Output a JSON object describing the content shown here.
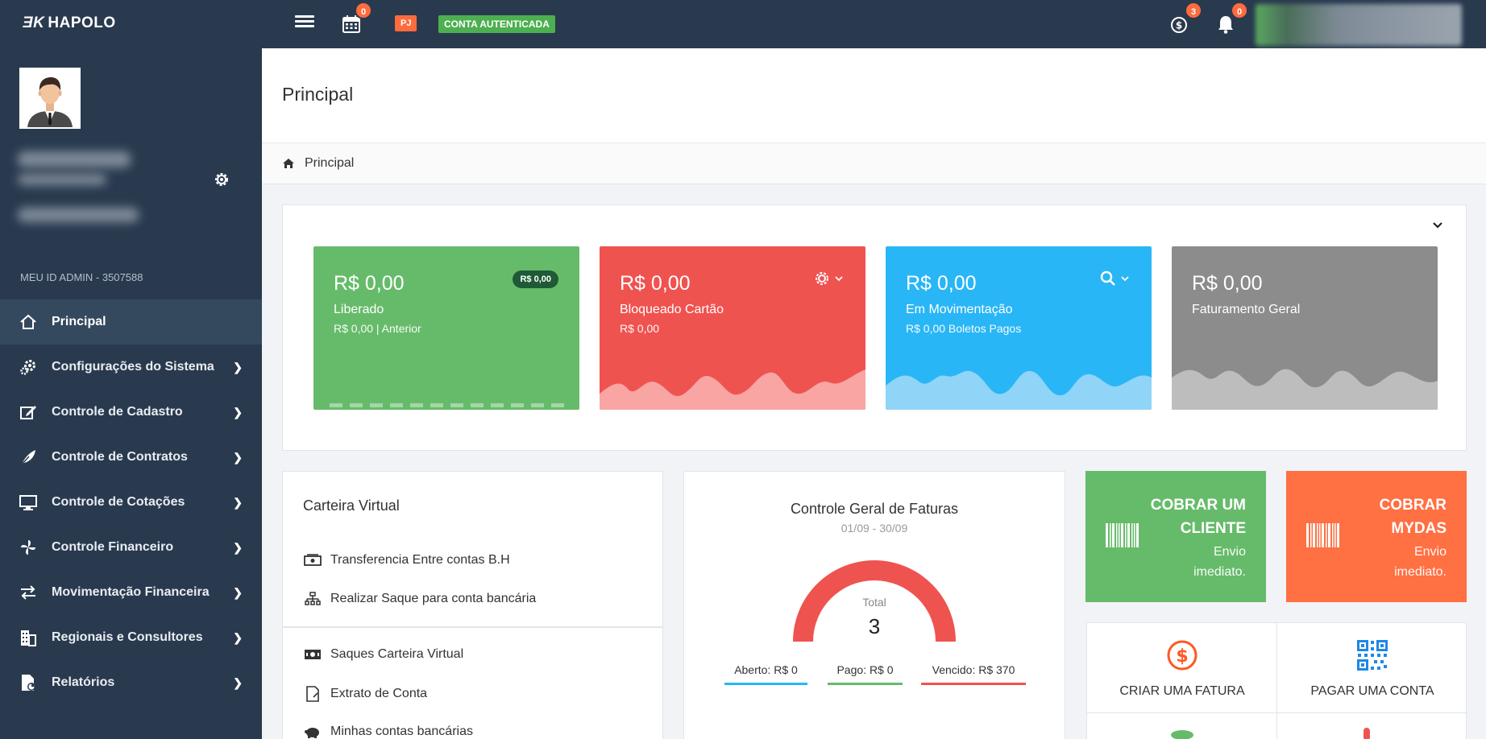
{
  "brand": {
    "mark": "ƎK",
    "name": "HAPOLO"
  },
  "topbar": {
    "calendar_count": "0",
    "pj_label": "PJ",
    "auth_label": "CONTA AUTENTICADA",
    "dollar_count": "3",
    "bell_count": "0"
  },
  "sidebar": {
    "admin_id": "MEU ID ADMIN - 3507588",
    "items": [
      {
        "label": "Principal",
        "icon": "home-icon"
      },
      {
        "label": "Configurações do Sistema",
        "icon": "cogs-icon"
      },
      {
        "label": "Controle de Cadastro",
        "icon": "edit-icon"
      },
      {
        "label": "Controle de Contratos",
        "icon": "feather-icon"
      },
      {
        "label": "Controle de Cotações",
        "icon": "monitor-icon"
      },
      {
        "label": "Controle Financeiro",
        "icon": "pinwheel-icon"
      },
      {
        "label": "Movimentação Financeira",
        "icon": "exchange-icon"
      },
      {
        "label": "Regionais e Consultores",
        "icon": "building-icon"
      },
      {
        "label": "Relatórios",
        "icon": "report-icon"
      }
    ]
  },
  "page": {
    "title": "Principal",
    "breadcrumb": "Principal"
  },
  "cards": [
    {
      "amount": "R$ 0,00",
      "label": "Liberado",
      "sub": "R$ 0,00 | Anterior",
      "pill": "R$ 0,00",
      "color": "#66bb6a"
    },
    {
      "amount": "R$ 0,00",
      "label": "Bloqueado Cartão",
      "sub": "R$ 0,00",
      "color": "#ef5350"
    },
    {
      "amount": "R$ 0,00",
      "label": "Em Movimentação",
      "sub": "R$ 0,00 Boletos Pagos",
      "color": "#29b6f6"
    },
    {
      "amount": "R$ 0,00",
      "label": "Faturamento Geral",
      "color": "#8c8c8c"
    }
  ],
  "wallet": {
    "title": "Carteira Virtual",
    "items": [
      {
        "label": "Transferencia Entre contas B.H",
        "icon": "money-transfer-icon"
      },
      {
        "label": "Realizar Saque para conta bancária",
        "icon": "sitemap-icon"
      },
      {
        "label": "Saques Carteira Virtual",
        "icon": "money-icon"
      },
      {
        "label": "Extrato de Conta",
        "icon": "document-icon"
      },
      {
        "label": "Minhas contas bancárias",
        "icon": "piggy-bank-icon"
      }
    ]
  },
  "invoices": {
    "title": "Controle Geral de Faturas",
    "range": "01/09 - 30/09",
    "total_label": "Total",
    "total": "3",
    "legend": [
      {
        "label": "Aberto: R$ 0",
        "color": "#29b6f6"
      },
      {
        "label": "Pago: R$ 0",
        "color": "#66bb6a"
      },
      {
        "label": "Vencido: R$ 370",
        "color": "#ef5350"
      }
    ]
  },
  "actions": [
    {
      "title_line1": "COBRAR UM",
      "title_line2": "CLIENTE",
      "sub_line1": "Envio",
      "sub_line2": "imediato.",
      "color": "#66bb6a"
    },
    {
      "title_line1": "COBRAR",
      "title_line2": "MYDAS",
      "sub_line1": "Envio",
      "sub_line2": "imediato.",
      "color": "#ff7043"
    }
  ],
  "quick": [
    {
      "label": "CRIAR UMA FATURA",
      "icon": "dollar-circle-icon"
    },
    {
      "label": "PAGAR UMA CONTA",
      "icon": "qrcode-icon"
    }
  ]
}
